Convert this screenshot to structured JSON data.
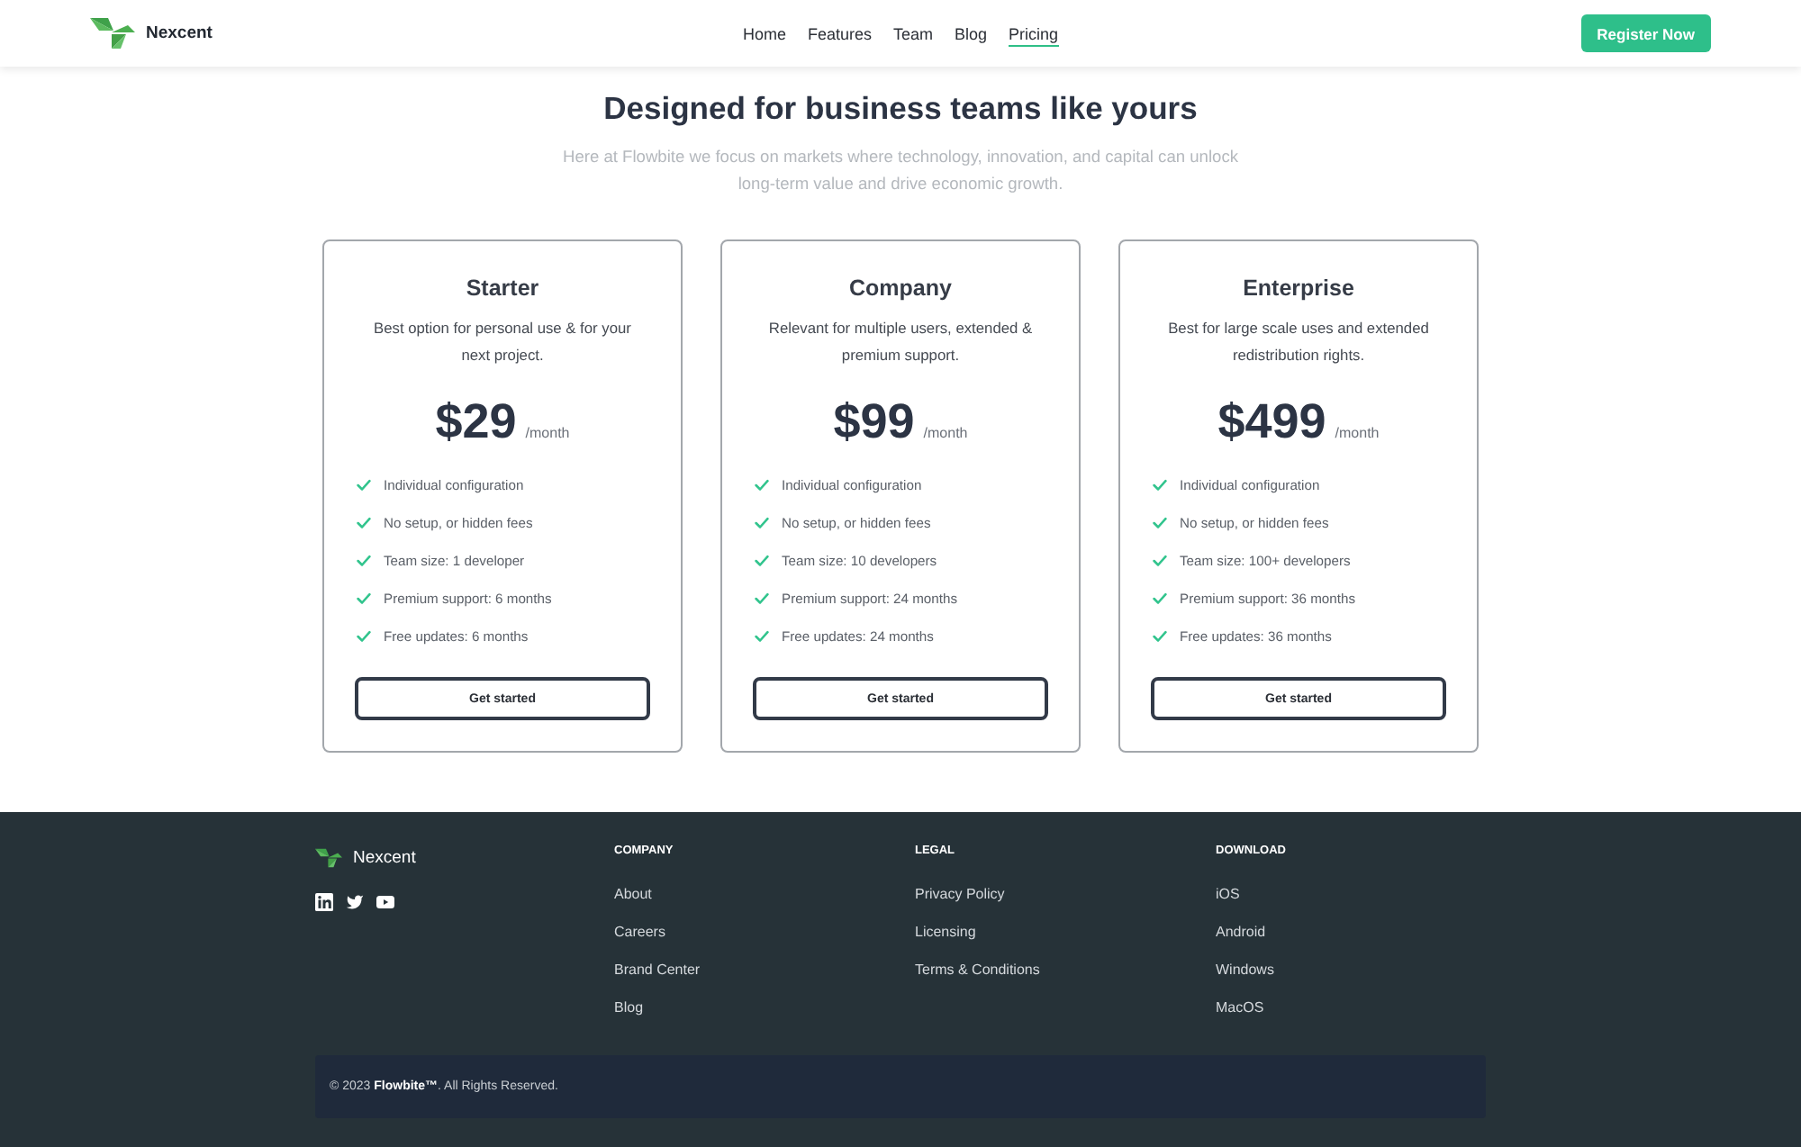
{
  "header": {
    "brand": "Nexcent",
    "nav": [
      {
        "label": "Home",
        "selected": false
      },
      {
        "label": "Features",
        "selected": false
      },
      {
        "label": "Team",
        "selected": false
      },
      {
        "label": "Blog",
        "selected": false
      },
      {
        "label": "Pricing",
        "selected": true
      }
    ],
    "cta": "Register Now"
  },
  "intro": {
    "title": "Designed for business teams like yours",
    "subtitle": "Here at Flowbite we focus on markets where technology, innovation, and capital can unlock long-term value and drive economic growth."
  },
  "plans": [
    {
      "name": "Starter",
      "description": "Best option for personal use & for your next project.",
      "price": "$29",
      "period": "/month",
      "features": [
        "Individual configuration",
        "No setup, or hidden fees",
        "Team size: 1 developer",
        "Premium support: 6 months",
        "Free updates: 6 months"
      ],
      "button": "Get started"
    },
    {
      "name": "Company",
      "description": "Relevant for multiple users, extended & premium support.",
      "price": "$99",
      "period": "/month",
      "features": [
        "Individual configuration",
        "No setup, or hidden fees",
        "Team size: 10 developers",
        "Premium support: 24 months",
        "Free updates: 24 months"
      ],
      "button": "Get started"
    },
    {
      "name": "Enterprise",
      "description": "Best for large scale uses and extended redistribution rights.",
      "price": "$499",
      "period": "/month",
      "features": [
        "Individual configuration",
        "No setup, or hidden fees",
        "Team size: 100+ developers",
        "Premium support: 36 months",
        "Free updates: 36 months"
      ],
      "button": "Get started"
    }
  ],
  "footer": {
    "brand": "Nexcent",
    "columns": [
      {
        "heading": "COMPANY",
        "links": [
          "About",
          "Careers",
          "Brand Center",
          "Blog"
        ]
      },
      {
        "heading": "LEGAL",
        "links": [
          "Privacy Policy",
          "Licensing",
          "Terms & Conditions"
        ]
      },
      {
        "heading": "DOWNLOAD",
        "links": [
          "iOS",
          "Android",
          "Windows",
          "MacOS"
        ]
      }
    ],
    "copyright": "© 2023 **Flowbite™**. All Rights Reserved."
  }
}
